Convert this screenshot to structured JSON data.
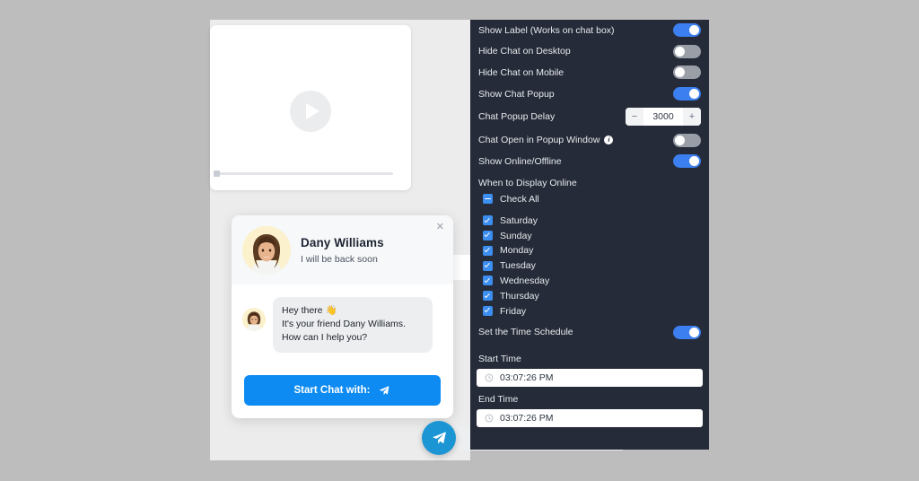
{
  "colors": {
    "page_bg": "#bdbdbd",
    "panel_bg": "#252b38",
    "toggle_on": "#3c7ff0",
    "toggle_off": "#9a9ea7",
    "checkbox": "#3c8ef0",
    "primary_button": "#0d8bf2",
    "fab": "#1b95d3",
    "avatar_bg": "#fbf1cd"
  },
  "preview": {
    "video_placeholder_icon": "play-icon",
    "progress_value": 0
  },
  "chat_card": {
    "close_label": "✕",
    "agent_name": "Dany Williams",
    "agent_status": "I will be back soon",
    "message_line1": "Hey there 👋",
    "message_line2": "It's your friend Dany Williams. How can I help you?",
    "start_button_label": "Start Chat with:",
    "start_button_icon": "telegram-plane-icon"
  },
  "fab": {
    "icon": "telegram-plane-icon"
  },
  "settings": {
    "toggles": [
      {
        "label": "Show Label (Works on chat box)",
        "state": "on",
        "name": "show-label"
      },
      {
        "label": "Hide Chat on Desktop",
        "state": "off",
        "name": "hide-chat-desktop"
      },
      {
        "label": "Hide Chat on Mobile",
        "state": "off",
        "name": "hide-chat-mobile"
      },
      {
        "label": "Show Chat Popup",
        "state": "on",
        "name": "show-chat-popup"
      }
    ],
    "delay": {
      "label": "Chat Popup Delay",
      "value": "3000",
      "decrement": "−",
      "increment": "+"
    },
    "popup_window": {
      "label": "Chat Open in Popup Window",
      "info_icon": "info-icon",
      "info_glyph": "i",
      "state": "off"
    },
    "online_offline": {
      "label": "Show Online/Offline",
      "state": "on"
    },
    "when_to_display": {
      "section_label": "When to Display Online",
      "check_all": {
        "label": "Check All",
        "state": "indeterminate"
      },
      "days": [
        {
          "label": "Saturday",
          "state": "checked"
        },
        {
          "label": "Sunday",
          "state": "checked"
        },
        {
          "label": "Monday",
          "state": "checked"
        },
        {
          "label": "Tuesday",
          "state": "checked"
        },
        {
          "label": "Wednesday",
          "state": "checked"
        },
        {
          "label": "Thursday",
          "state": "checked"
        },
        {
          "label": "Friday",
          "state": "checked"
        }
      ]
    },
    "time_schedule": {
      "label": "Set the Time Schedule",
      "state": "on",
      "start_label": "Start Time",
      "start_value": "03:07:26 PM",
      "end_label": "End Time",
      "end_value": "03:07:26 PM",
      "clock_icon": "clock-icon"
    }
  }
}
